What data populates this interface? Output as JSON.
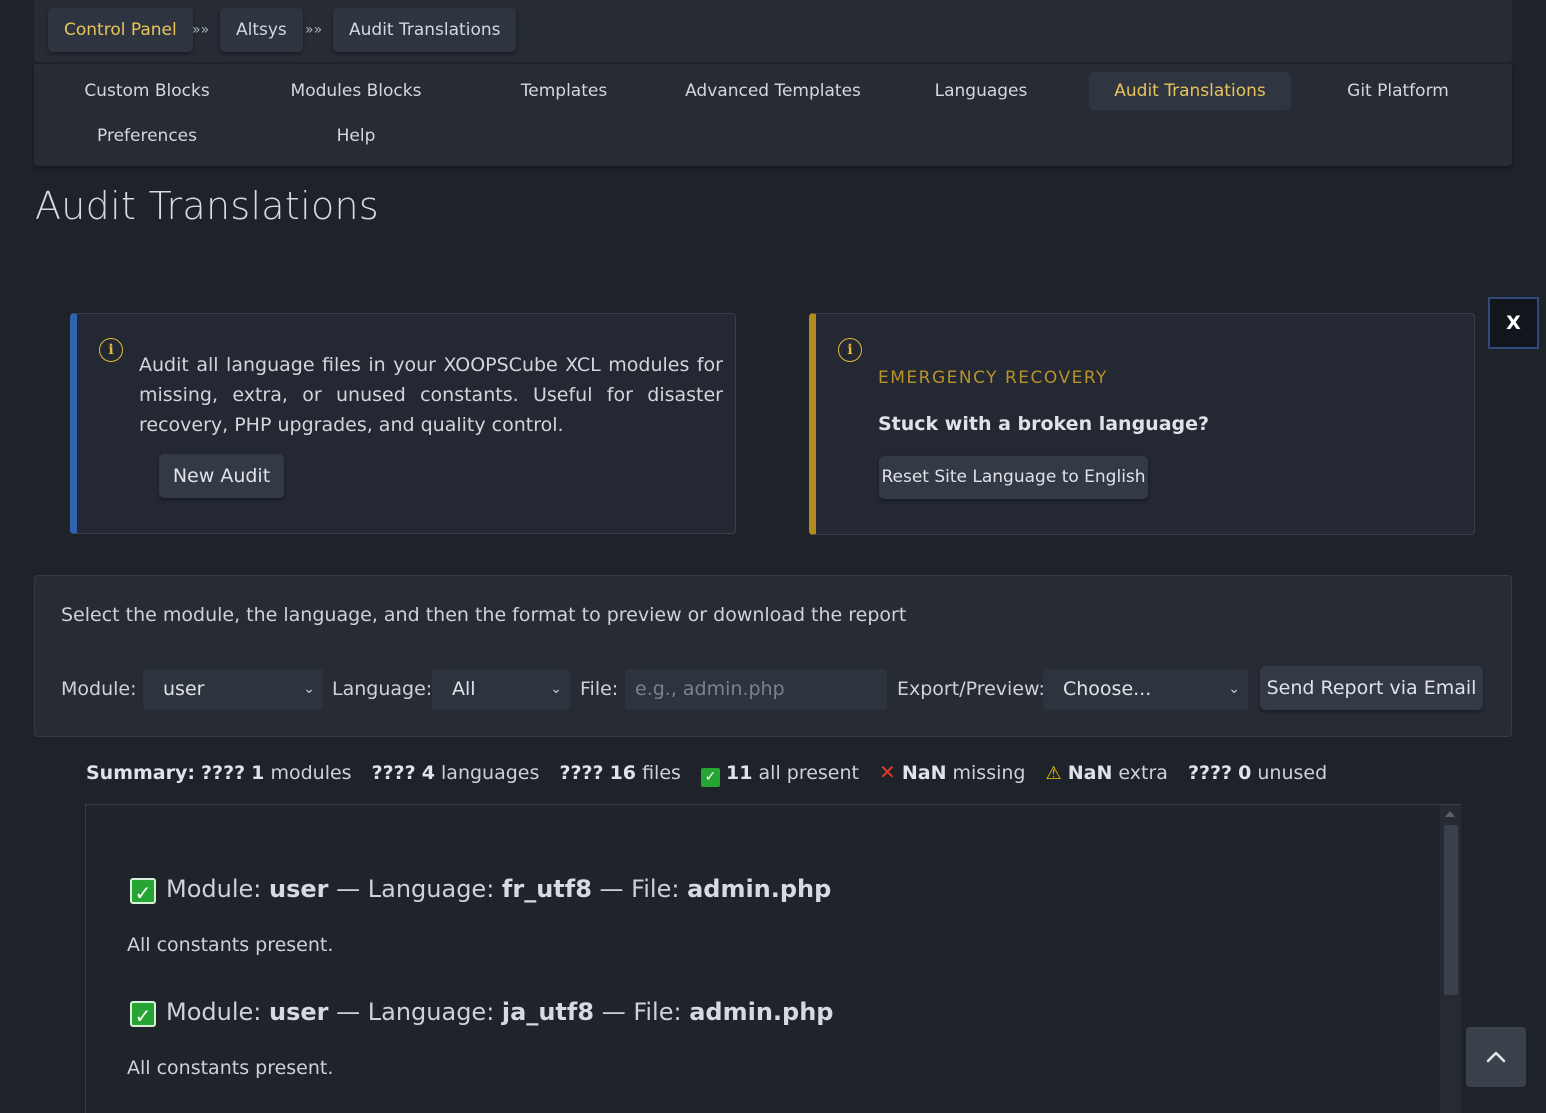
{
  "breadcrumb": {
    "items": [
      "Control Panel",
      "Altsys",
      "Audit Translations"
    ],
    "separator": "»»"
  },
  "tabs": [
    {
      "label": "Custom Blocks"
    },
    {
      "label": "Modules Blocks"
    },
    {
      "label": "Templates"
    },
    {
      "label": "Advanced Templates"
    },
    {
      "label": "Languages"
    },
    {
      "label": "Audit Translations",
      "active": true
    },
    {
      "label": "Git Platform"
    },
    {
      "label": "Preferences"
    },
    {
      "label": "Help"
    }
  ],
  "page_title": "Audit Translations",
  "close_label": "X",
  "info_card": {
    "icon": "info-icon",
    "text": "Audit all language files in your XOOPSCube XCL modules for missing, extra, or unused constants. Useful for disaster recovery, PHP upgrades, and quality control.",
    "button": "New Audit"
  },
  "emergency_card": {
    "icon": "info-icon",
    "title": "EMERGENCY RECOVERY",
    "subtitle": "Stuck with a broken language?",
    "button": "Reset Site Language to English"
  },
  "form": {
    "intro": "Select the module, the language, and then the format to preview or download the report",
    "module_label": "Module:",
    "module_value": "user",
    "language_label": "Language:",
    "language_value": "All",
    "file_label": "File:",
    "file_placeholder": "e.g., admin.php",
    "export_label": "Export/Preview:",
    "export_value": "Choose...",
    "send_button": "Send Report via Email"
  },
  "summary": {
    "label": "Summary:",
    "modules_prefix": "????",
    "modules_count": "1",
    "modules_word": "modules",
    "languages_prefix": "????",
    "languages_count": "4",
    "languages_word": "languages",
    "files_prefix": "????",
    "files_count": "16",
    "files_word": "files",
    "present_count": "11",
    "present_word": "all present",
    "missing_count": "NaN",
    "missing_word": "missing",
    "extra_count": "NaN",
    "extra_word": "extra",
    "unused_prefix": "????",
    "unused_count": "0",
    "unused_word": "unused"
  },
  "results": [
    {
      "module_label": "Module:",
      "module": "user",
      "language_label": "— Language:",
      "language": "fr_utf8",
      "file_label": "— File:",
      "file": "admin.php",
      "message": "All constants present."
    },
    {
      "module_label": "Module:",
      "module": "user",
      "language_label": "— Language:",
      "language": "ja_utf8",
      "file_label": "— File:",
      "file": "admin.php",
      "message": "All constants present."
    }
  ]
}
